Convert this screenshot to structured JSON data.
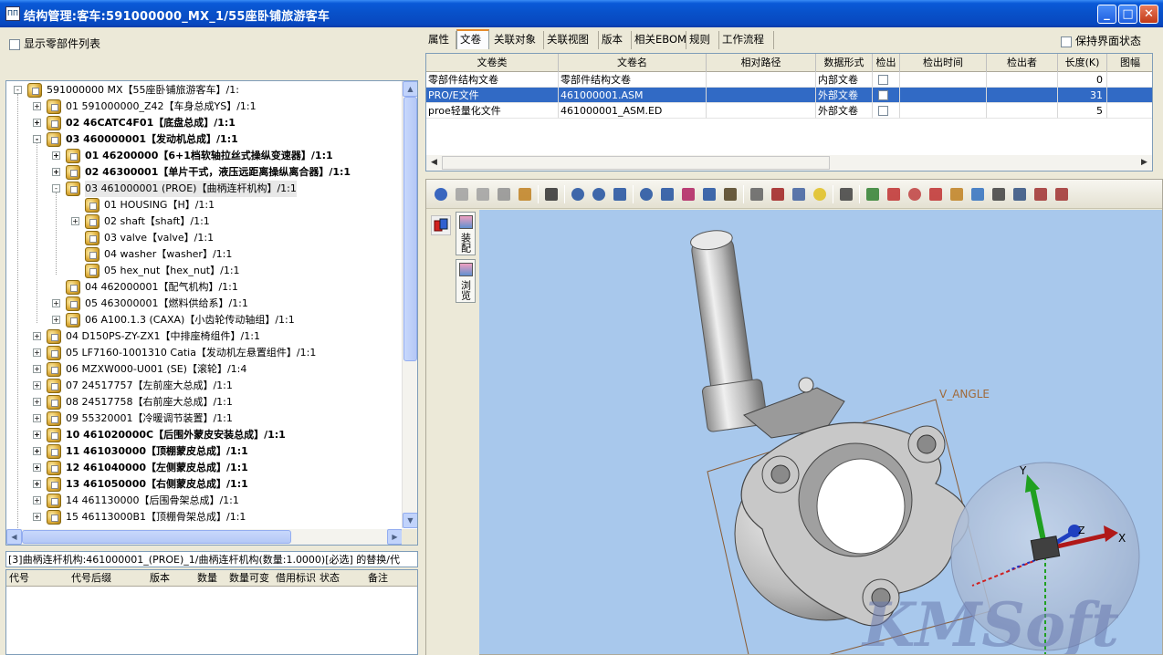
{
  "window": {
    "title": "结构管理:客车:591000000_MX_1/55座卧铺旅游客车",
    "app_icon_text": "ΠΠ",
    "minimize": "_",
    "maximize": "□",
    "close": "✕"
  },
  "left": {
    "show_parts_label": "显示零部件列表",
    "tree_items": [
      {
        "label": "591000000 MX【55座卧铺旅游客车】/1:",
        "bold": false
      },
      {
        "label": "01 591000000_Z42【车身总成YS】/1:1",
        "bold": false
      },
      {
        "label": "02 46CATC4F01【底盘总成】/1:1",
        "bold": true
      },
      {
        "label": "03 460000001【发动机总成】/1:1",
        "bold": true
      },
      {
        "label": "01 46200000【6+1档软轴拉丝式操纵变速器】/1:1",
        "bold": true
      },
      {
        "label": "02 46300001【单片干式，液压远距离操纵离合器】/1:1",
        "bold": true
      },
      {
        "label": "03 461000001 (PROE)【曲柄连杆机构】/1:1",
        "bold": false
      },
      {
        "label": "01 HOUSING【H】/1:1",
        "bold": false
      },
      {
        "label": "02 shaft【shaft】/1:1",
        "bold": false
      },
      {
        "label": "03 valve【valve】/1:1",
        "bold": false
      },
      {
        "label": "04 washer【washer】/1:1",
        "bold": false
      },
      {
        "label": "05 hex_nut【hex_nut】/1:1",
        "bold": false
      },
      {
        "label": "04 462000001【配气机构】/1:1",
        "bold": false
      },
      {
        "label": "05 463000001【燃料供给系】/1:1",
        "bold": false
      },
      {
        "label": "06 A100.1.3 (CAXA)【小齿轮传动轴组】/1:1",
        "bold": false
      },
      {
        "label": "04 D150PS-ZY-ZX1【中排座椅组件】/1:1",
        "bold": false
      },
      {
        "label": "05 LF7160-1001310 Catia【发动机左悬置组件】/1:1",
        "bold": false
      },
      {
        "label": "06 MZXW000-U001 (SE)【滚轮】/1:4",
        "bold": false
      },
      {
        "label": "07 24517757【左前座大总成】/1:1",
        "bold": false
      },
      {
        "label": "08 24517758【右前座大总成】/1:1",
        "bold": false
      },
      {
        "label": "09 55320001【冷暖调节装置】/1:1",
        "bold": false
      },
      {
        "label": "10 461020000C【后围外蒙皮安装总成】/1:1",
        "bold": true
      },
      {
        "label": "11 461030000【顶棚蒙皮总成】/1:1",
        "bold": true
      },
      {
        "label": "12 461040000【左侧蒙皮总成】/1:1",
        "bold": true
      },
      {
        "label": "13 461050000【右侧蒙皮总成】/1:1",
        "bold": true
      },
      {
        "label": "14 461130000【后围骨架总成】/1:1",
        "bold": false
      },
      {
        "label": "15 46113000B1【顶棚骨架总成】/1:1",
        "bold": false
      }
    ],
    "status_text": "[3]曲柄连杆机构:461000001_(PROE)_1/曲柄连杆机构(数量:1.0000)[必选] 的替换/代",
    "sub_columns": [
      "代号",
      "代号后缀",
      "版本",
      "数量",
      "数量可变",
      "借用标识",
      "状态",
      "备注"
    ]
  },
  "right": {
    "tabs": [
      "属性",
      "文卷",
      "关联对象",
      "关联视图",
      "版本",
      "相关EBOM",
      "规则",
      "工作流程"
    ],
    "active_tab": 1,
    "keep_state_label": "保持界面状态",
    "doc_columns": [
      "文卷类",
      "文卷名",
      "相对路径",
      "数据形式",
      "检出",
      "检出时间",
      "检出者",
      "长度(K)",
      "图幅"
    ],
    "doc_rows": [
      {
        "type": "零部件结构文卷",
        "name": "零部件结构文卷",
        "path": "",
        "form": "内部文卷",
        "time": "",
        "by": "",
        "size": "0"
      },
      {
        "type": "PRO/E文件",
        "name": "461000001.ASM",
        "path": "",
        "form": "外部文卷",
        "time": "",
        "by": "",
        "size": "31"
      },
      {
        "type": "proe轻量化文件",
        "name": "461000001_ASM.ED",
        "path": "",
        "form": "外部文卷",
        "time": "",
        "by": "",
        "size": "5"
      }
    ],
    "viewer": {
      "side_tabs": [
        "装配",
        "浏览"
      ],
      "annotation": "V_ANGLE",
      "axis_x": "X",
      "axis_y": "Y",
      "axis_z": "Z",
      "watermark": "KMSoft"
    }
  }
}
